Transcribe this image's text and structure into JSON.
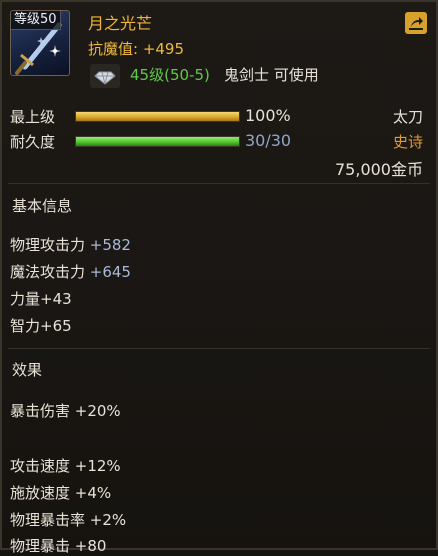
{
  "item": {
    "level_badge": "等级50",
    "name": "月之光芒",
    "resist": "抗魔值: +495",
    "req_level": "45级(50-5)",
    "req_class": "鬼剑士 可使用"
  },
  "bars": {
    "max_level": {
      "label": "最上级",
      "value_text": "100%",
      "fill_percent": 100,
      "right": "太刀"
    },
    "durability": {
      "label": "耐久度",
      "value_text": "30/30",
      "fill_percent": 100,
      "right": "史诗"
    }
  },
  "price": "75,000金币",
  "basic": {
    "title": "基本信息",
    "stats": [
      {
        "label": "物理攻击力 ",
        "value": "+582"
      },
      {
        "label": "魔法攻击力 ",
        "value": "+645"
      },
      {
        "label": "力量",
        "value": "+43"
      },
      {
        "label": "智力",
        "value": "+65"
      }
    ]
  },
  "effects": {
    "title": "效果",
    "stats": [
      {
        "label": "暴击伤害 ",
        "value": "+20%"
      },
      {
        "label": "攻击速度 ",
        "value": "+12%"
      },
      {
        "label": "施放速度 ",
        "value": "+4%"
      },
      {
        "label": "物理暴击率 ",
        "value": "+2%"
      },
      {
        "label": "物理暴击 ",
        "value": "+80"
      }
    ]
  },
  "colors": {
    "gold": "#f0b83a",
    "green": "#62c94a",
    "blue_value": "#a9bbd6",
    "epic": "#e39a2c"
  }
}
